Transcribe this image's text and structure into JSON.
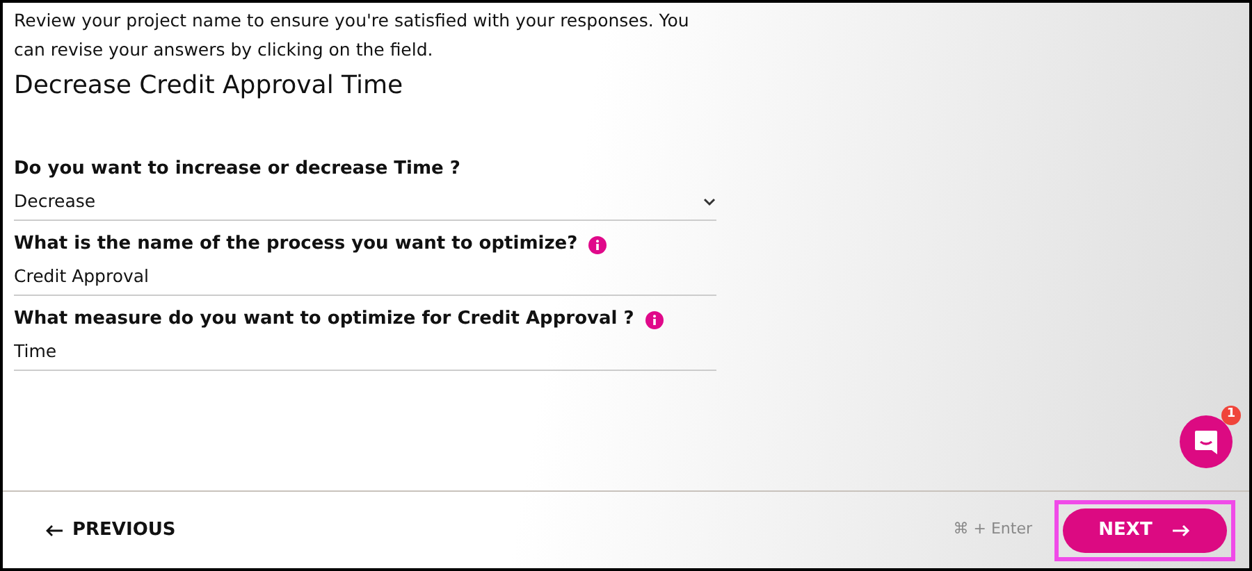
{
  "intro": "Review your project name to ensure you're satisfied with your responses. You can revise your answers by clicking on the field.",
  "project_title": "Decrease Credit Approval Time",
  "fields": [
    {
      "kind": "select",
      "label": "Do you want to increase or decrease Time ?",
      "value": "Decrease",
      "info": false
    },
    {
      "kind": "text",
      "label": "What is the name of the process you want to optimize?",
      "value": "Credit Approval",
      "info": true
    },
    {
      "kind": "text",
      "label": "What measure do you want to optimize for Credit Approval ?",
      "value": "Time",
      "info": true
    }
  ],
  "chat": {
    "badge": "1"
  },
  "footer": {
    "previous": "PREVIOUS",
    "shortcut": "⌘ + Enter",
    "next": "NEXT"
  }
}
